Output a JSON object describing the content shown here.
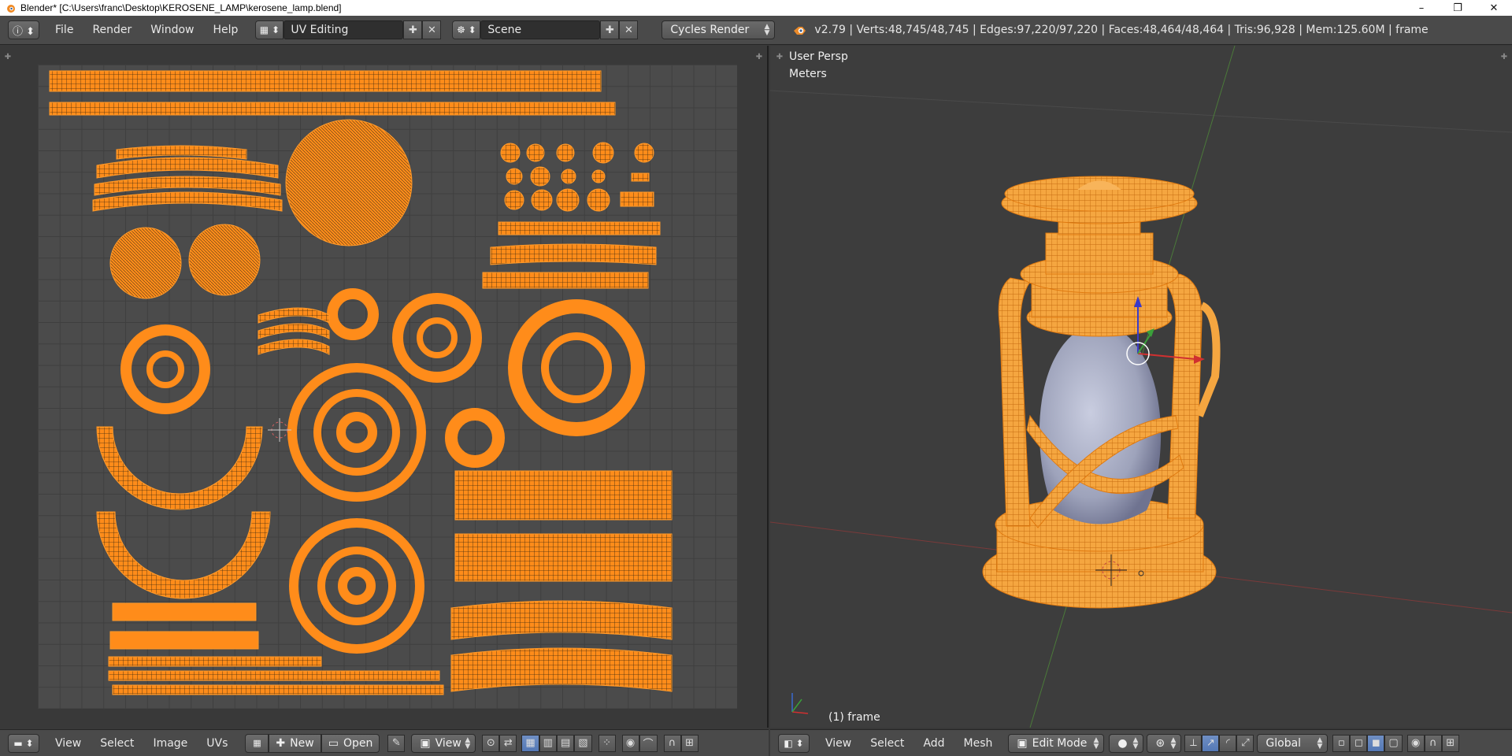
{
  "titlebar": {
    "title": "Blender* [C:\\Users\\franc\\Desktop\\KEROSENE_LAMP\\kerosene_lamp.blend]",
    "minimize": "–",
    "restore": "❐",
    "close": "✕"
  },
  "infobar": {
    "menus": [
      "File",
      "Render",
      "Window",
      "Help"
    ],
    "screen_layout": "UV Editing",
    "scene": "Scene",
    "render_engine": "Cycles Render",
    "stats": "v2.79 | Verts:48,745/48,745 | Edges:97,220/97,220 | Faces:48,464/48,464 | Tris:96,928 | Mem:125.60M | frame"
  },
  "viewport": {
    "view_name": "User Persp",
    "units": "Meters",
    "object_label": "(1) frame"
  },
  "uv_header": {
    "menus": [
      "View",
      "Select",
      "Image",
      "UVs"
    ],
    "new_label": "New",
    "open_label": "Open",
    "view_label": "View"
  },
  "view3d_header": {
    "menus": [
      "View",
      "Select",
      "Add",
      "Mesh"
    ],
    "mode": "Edit Mode",
    "orientation": "Global"
  },
  "colors": {
    "uv_wire": "#ff8c1a",
    "header_bg": "#4a4a4a",
    "viewport_bg": "#3d3d3d",
    "glass": "#a9adc3"
  }
}
